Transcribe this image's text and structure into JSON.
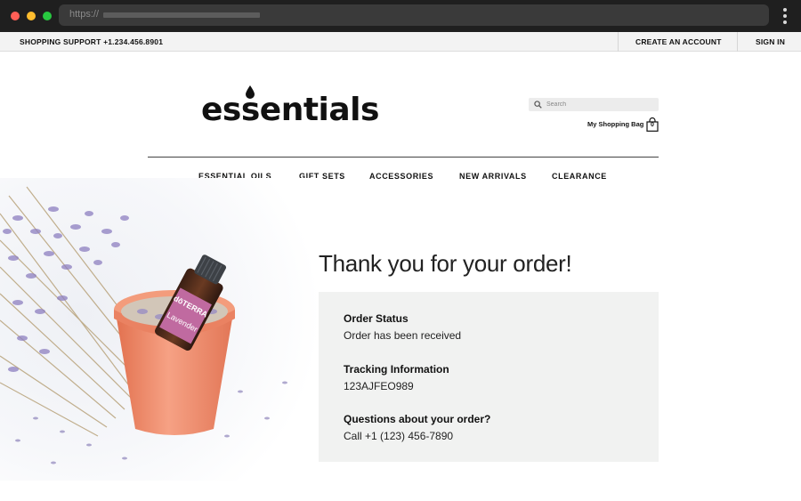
{
  "browser": {
    "url_protocol": "https://"
  },
  "topbar": {
    "support_label": "SHOPPING SUPPORT",
    "support_phone": "+1.234.456.8901",
    "create_account": "CREATE AN ACCOUNT",
    "sign_in": "SIGN IN"
  },
  "header": {
    "logo_text": "essentials",
    "search_placeholder": "Search",
    "bag_label": "My Shopping Bag",
    "bag_count": "0"
  },
  "nav": {
    "items": [
      "ESSENTIAL OILS",
      "GIFT SETS",
      "ACCESSORIES",
      "NEW ARRIVALS",
      "CLEARANCE"
    ]
  },
  "hero": {
    "bottle_brand": "dōTERRA",
    "bottle_product": "Lavender"
  },
  "confirmation": {
    "title": "Thank you for your order!",
    "sections": [
      {
        "heading": "Order Status",
        "value": "Order has been received"
      },
      {
        "heading": "Tracking Information",
        "value": "123AJFEO989"
      },
      {
        "heading": "Questions about your order?",
        "value": "Call +1 (123) 456-7890"
      }
    ]
  },
  "colors": {
    "chrome_bg": "#1f1f1f",
    "topbar_bg": "#f3f3f3",
    "panel_bg": "#f1f2f1",
    "pot": "#f08a6a",
    "lavender": "#8d7fc0",
    "bottle_label": "#c06aa0"
  }
}
